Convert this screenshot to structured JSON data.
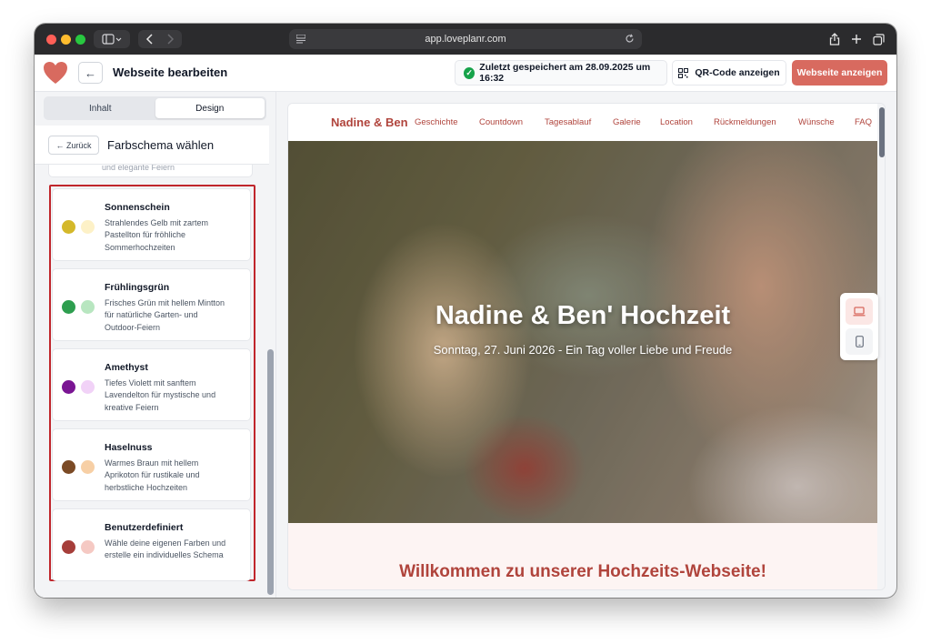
{
  "browser": {
    "url": "app.loveplanr.com"
  },
  "header": {
    "title": "Webseite bearbeiten",
    "save_status": "Zuletzt gespeichert am 28.09.2025 um 16:32",
    "qr_label": "QR-Code anzeigen",
    "view_label": "Webseite anzeigen"
  },
  "sidebar": {
    "tabs": [
      {
        "label": "Inhalt",
        "active": false
      },
      {
        "label": "Design",
        "active": true
      }
    ],
    "back_label": "← Zurück",
    "section_title": "Farbschema wählen",
    "prev_card_text": "und elegante Feiern",
    "schemes": [
      {
        "name": "Sonnenschein",
        "description": "Strahlendes Gelb mit zartem Pastellton für fröhliche Sommerhochzeiten",
        "primary": "#d4b82a",
        "secondary": "#fdf1c7"
      },
      {
        "name": "Frühlingsgrün",
        "description": "Frisches Grün mit hellem Mintton für natürliche Garten- und Outdoor-Feiern",
        "primary": "#2e9e4f",
        "secondary": "#b8e6c0"
      },
      {
        "name": "Amethyst",
        "description": "Tiefes Violett mit sanftem Lavendelton für mystische und kreative Feiern",
        "primary": "#7a1593",
        "secondary": "#f1d2f7"
      },
      {
        "name": "Haselnuss",
        "description": "Warmes Braun mit hellem Aprikoton für rustikale und herbstliche Hochzeiten",
        "primary": "#7b4a25",
        "secondary": "#f7cfa5"
      },
      {
        "name": "Benutzerdefiniert",
        "description": "Wähle deine eigenen Farben und erstelle ein individuelles Schema",
        "primary": "#a63e3a",
        "secondary": "#f5c9c3"
      }
    ]
  },
  "preview": {
    "brand": "Nadine & Ben",
    "nav": [
      "Geschichte",
      "Countdown",
      "Tagesablauf",
      "Galerie",
      "Location",
      "Rückmeldungen",
      "Wünsche",
      "FAQ"
    ],
    "hero_title": "Nadine & Ben' Hochzeit",
    "hero_subtitle": "Sonntag, 27. Juni 2026 - Ein Tag voller Liebe und Freude",
    "welcome_title": "Willkommen zu unserer Hochzeits-Webseite!",
    "accent_color": "#b0443c"
  }
}
